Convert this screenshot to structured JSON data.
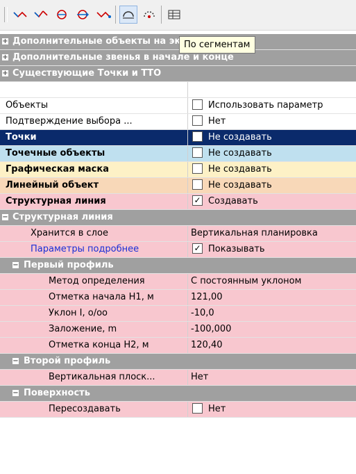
{
  "tooltip": "По сегментам",
  "categories": {
    "additional_objects": "Дополнительные объекты на эквидистанте",
    "additional_links": "Дополнительные звенья в начале и конце",
    "existing_points": "Существующие Точки и ТТО",
    "structural_line": "Структурная линия",
    "first_profile": "Первый профиль",
    "second_profile": "Второй профиль",
    "surface": "Поверхность"
  },
  "rows": {
    "objects": {
      "label": "Объекты",
      "value": "Использовать параметр"
    },
    "confirm": {
      "label": "Подтверждение выбора ...",
      "value": "Нет"
    },
    "points": {
      "label": "Точки",
      "value": "Не создавать"
    },
    "point_objects": {
      "label": "Точечные объекты",
      "value": "Не создавать"
    },
    "graphic_mask": {
      "label": "Графическая маска",
      "value": "Не создавать"
    },
    "linear_object": {
      "label": "Линейный объект",
      "value": "Не создавать"
    },
    "structural_line": {
      "label": "Структурная линия",
      "value": "Создавать",
      "checked": true
    },
    "stored_layer": {
      "label": "Хранится в слое",
      "value": "Вертикальная планировка"
    },
    "params_more": {
      "label": "Параметры подробнее",
      "value": "Показывать",
      "checked": true
    },
    "method": {
      "label": "Метод определения",
      "value": "С постоянным уклоном"
    },
    "elev_start": {
      "label": "Отметка начала H1, м",
      "value": "121,00"
    },
    "slope": {
      "label": "Уклон I,  о/оо",
      "value": "-10,0"
    },
    "offset": {
      "label": "Заложение, m",
      "value": "-100,000"
    },
    "elev_end": {
      "label": "Отметка конца H2, м",
      "value": "120,40"
    },
    "vertical_plane": {
      "label": "Вертикальная плоск...",
      "value": "Нет"
    },
    "recreate": {
      "label": "Пересоздавать",
      "value": "Нет"
    }
  },
  "icons": [
    "segment-arrow-icon",
    "segment-break-icon",
    "arc-point-icon",
    "arc-arrows-icon",
    "segment-end-icon",
    "by-segments-icon",
    "segments-gear-icon",
    "table-icon"
  ],
  "colors": {
    "category": "#a0a0a0",
    "selected": "#0a2a6b",
    "pink": "#f8c7cf",
    "blue": "#bfe0ef",
    "yellow": "#fdf1c6",
    "peach": "#f8d8b8"
  }
}
